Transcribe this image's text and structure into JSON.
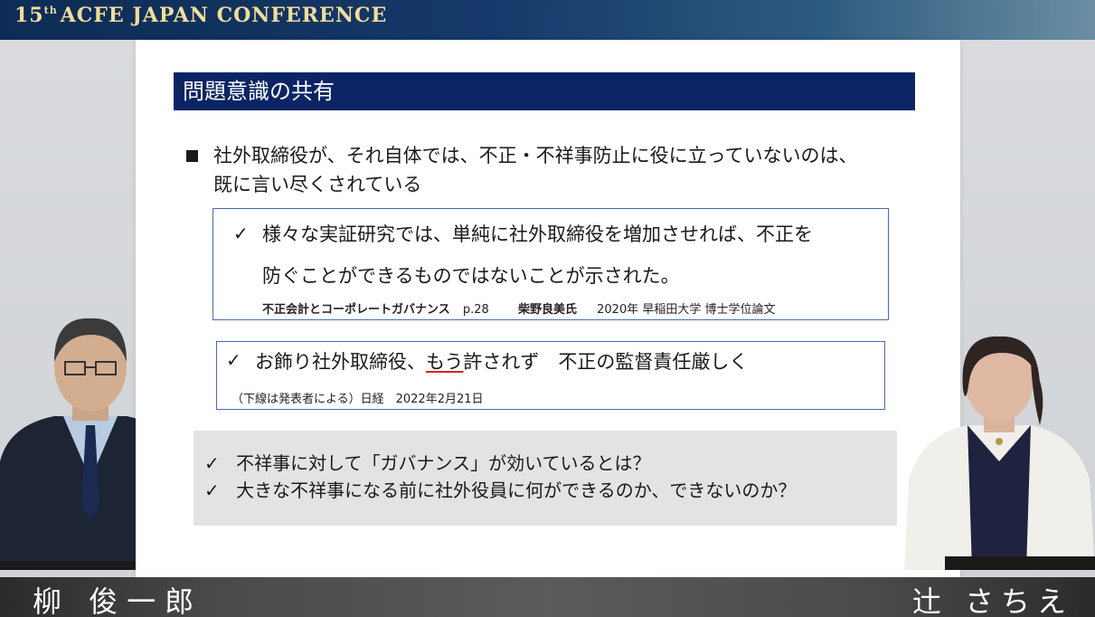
{
  "banner": {
    "ordinal": "15",
    "ordinal_suffix": "th",
    "title": "ACFE JAPAN CONFERENCE"
  },
  "slide": {
    "title": "問題意識の共有",
    "bullet": {
      "line1": "社外取締役が、それ自体では、不正・不祥事防止に役に立っていないのは、",
      "line2": "既に言い尽くされている"
    },
    "box1": {
      "check": "✓",
      "line1": "様々な実証研究では、単純に社外取締役を増加させれば、不正を",
      "line2": "防ぐことができるものではないことが示された。",
      "cite_title": "不正会計とコーポレートガバナンス",
      "cite_page": "p.28",
      "cite_author": "柴野良美氏",
      "cite_rest": "2020年 早稲田大学 博士学位論文"
    },
    "box2": {
      "check": "✓",
      "text_before": "お飾り社外取締役、",
      "text_underlined": "もう",
      "text_after": "許されず　不正の監督責任厳しく",
      "cite": "（下線は発表者による）日経　2022年2月21日"
    },
    "questions": [
      {
        "check": "✓",
        "text": "不祥事に対して「ガバナンス」が効いているとは？"
      },
      {
        "check": "✓",
        "text": "大きな不祥事になる前に社外役員に何ができるのか、できないのか？"
      }
    ]
  },
  "speakers": {
    "left_name": "柳 俊一郎",
    "right_name": "辻 さちえ"
  },
  "colors": {
    "banner_navy": "#0d2c55",
    "title_bar": "#0b2463",
    "box_border": "#4a6bb0",
    "banner_gold": "#f2dd9a"
  }
}
